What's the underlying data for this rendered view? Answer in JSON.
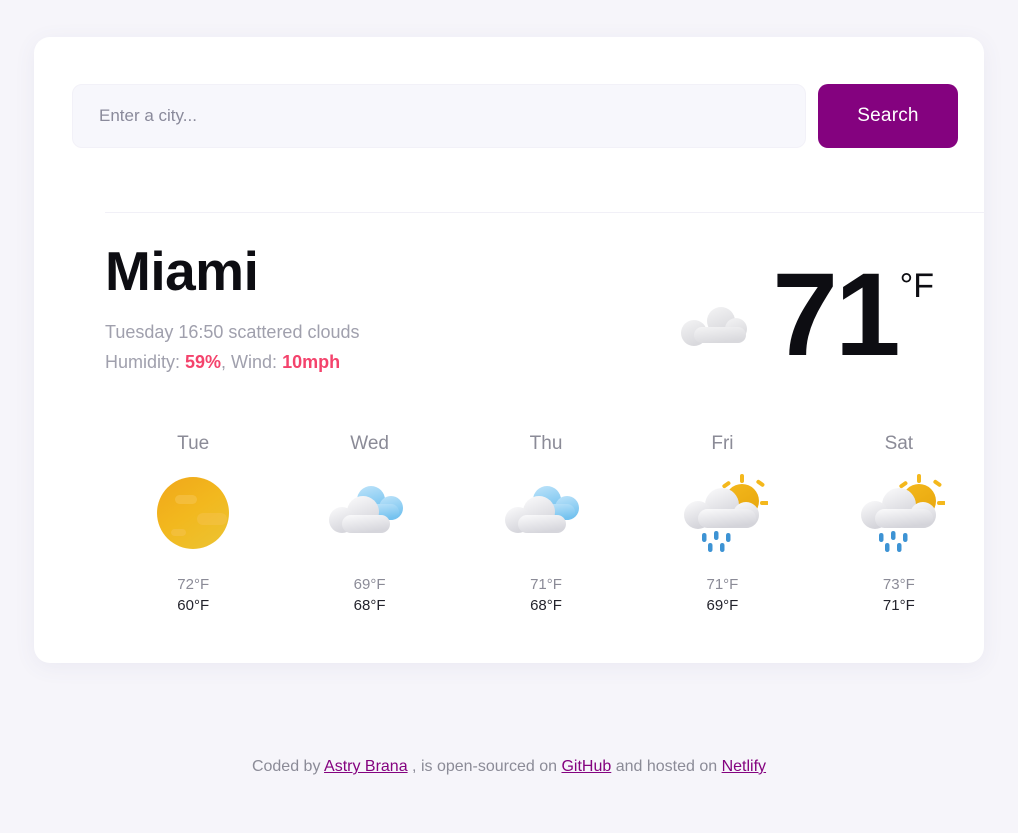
{
  "search": {
    "placeholder": "Enter a city...",
    "value": "",
    "button_label": "Search"
  },
  "current": {
    "city": "Miami",
    "description_line": "Tuesday 16:50 scattered clouds",
    "humidity_label": "Humidity: ",
    "humidity_value": "59%",
    "wind_separator": ", Wind: ",
    "wind_value": "10mph",
    "temperature": "71",
    "unit": "°F",
    "icon": "scattered-clouds-icon"
  },
  "forecast": [
    {
      "day": "Tue",
      "icon": "sun-icon",
      "high": "72°F",
      "low": "60°F"
    },
    {
      "day": "Wed",
      "icon": "broken-clouds-icon",
      "high": "69°F",
      "low": "68°F"
    },
    {
      "day": "Thu",
      "icon": "broken-clouds-icon",
      "high": "71°F",
      "low": "68°F"
    },
    {
      "day": "Fri",
      "icon": "sun-rain-cloud-icon",
      "high": "71°F",
      "low": "69°F"
    },
    {
      "day": "Sat",
      "icon": "sun-rain-cloud-icon",
      "high": "73°F",
      "low": "71°F"
    }
  ],
  "footer": {
    "prefix": "Coded by ",
    "author": "Astry Brana",
    "middle": " , is open-sourced on ",
    "source_link": "GitHub",
    "middle2": " and hosted on ",
    "host_link": "Netlify"
  },
  "colors": {
    "page_background": "#f6f5fa",
    "card_background": "#ffffff",
    "accent_pink": "#f4436c",
    "brand_purple": "#84027f",
    "muted_text": "#8b8b97",
    "sun_yellow": "#f0b41c",
    "rain_blue": "#3d93d4",
    "cloud_blue": "#9ad2f2"
  }
}
